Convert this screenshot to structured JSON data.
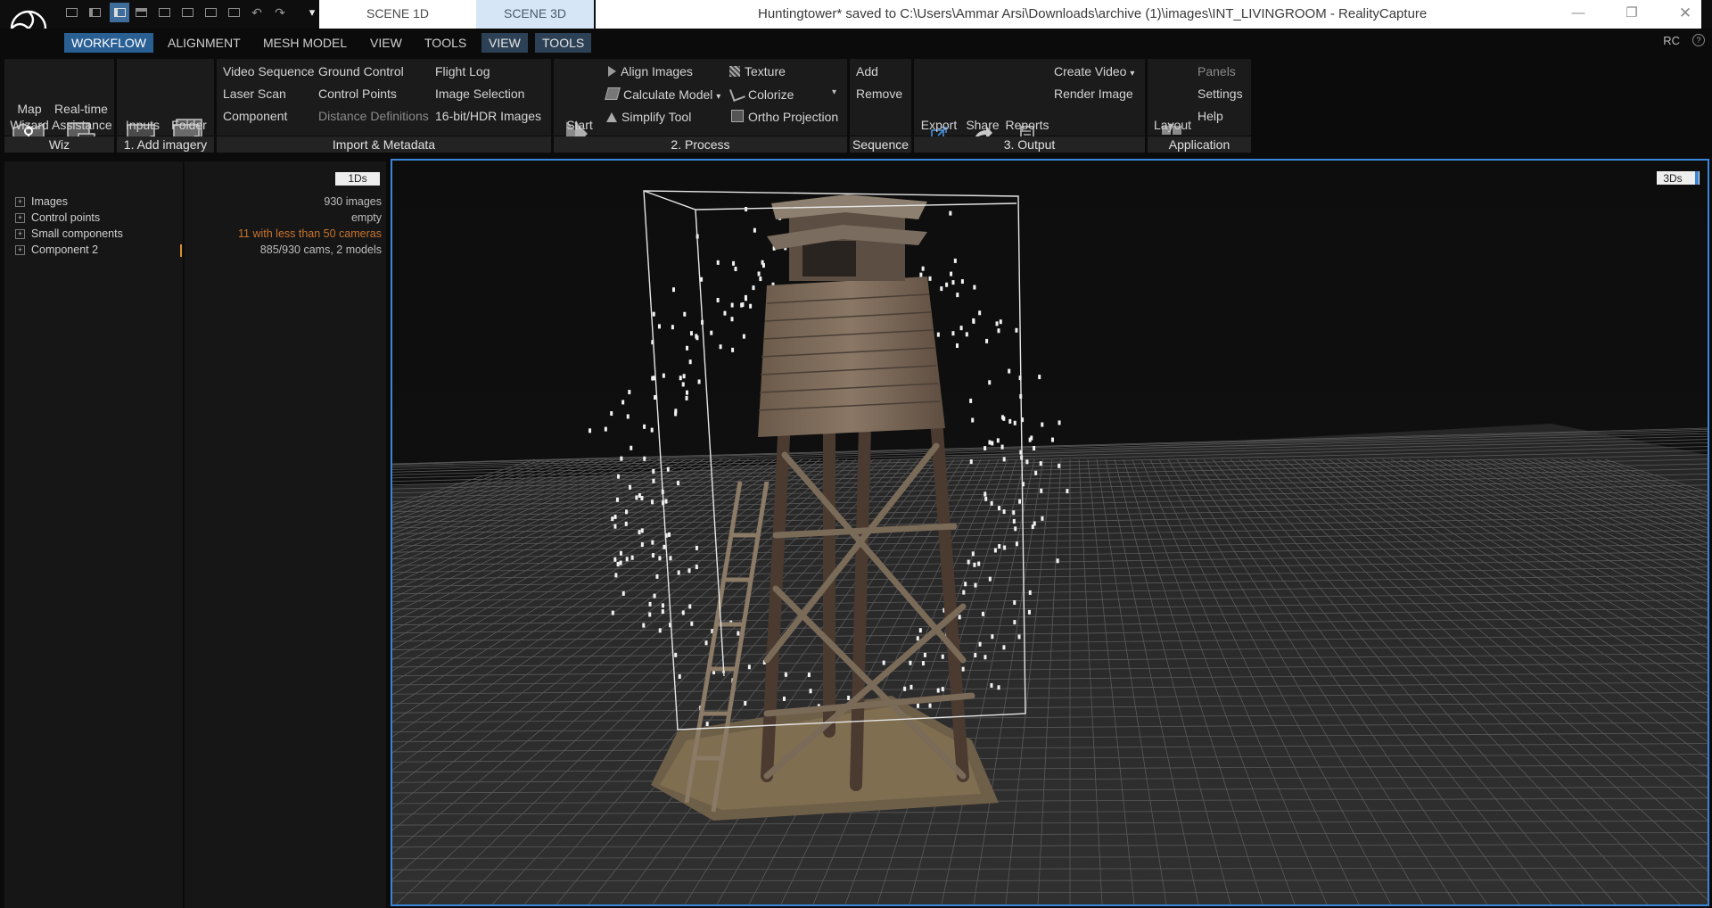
{
  "window": {
    "title": "Huntingtower* saved to C:\\Users\\Ammar Arsi\\Downloads\\archive (1)\\images\\INT_LIVINGROOM - RealityCapture",
    "scene_tabs": [
      "SCENE 1D",
      "SCENE 3D"
    ],
    "quick_access_marker": "▾"
  },
  "menubar": {
    "items": [
      "WORKFLOW",
      "ALIGNMENT",
      "MESH MODEL",
      "VIEW",
      "TOOLS",
      "VIEW",
      "TOOLS"
    ],
    "right_label": "RC",
    "help_glyph": "?"
  },
  "ribbon": {
    "wiz": {
      "label": "Wiz",
      "map_wizard": [
        "Map",
        "Wizard"
      ],
      "realtime": [
        "Real-time",
        "Assistance"
      ]
    },
    "add_imagery": {
      "label": "1. Add imagery",
      "inputs": "Inputs",
      "folder": "Folder"
    },
    "import": {
      "label": "Import & Metadata",
      "col1": [
        "Video Sequence",
        "Laser Scan",
        "Component"
      ],
      "col2": [
        "Ground Control",
        "Control Points",
        "Distance Definitions"
      ],
      "col3": [
        "Flight Log",
        "Image Selection",
        "16-bit/HDR Images"
      ]
    },
    "process": {
      "label": "2. Process",
      "start": "Start",
      "col1": [
        "Align Images",
        "Calculate Model",
        "Simplify Tool"
      ],
      "col2": [
        "Texture",
        "Colorize",
        "Ortho Projection"
      ]
    },
    "sequence": {
      "label": "Sequence",
      "items": [
        "Add",
        "Remove"
      ]
    },
    "output": {
      "label": "3. Output",
      "export": "Export",
      "share": "Share",
      "reports": "Reports",
      "items": [
        "Create Video",
        "Render Image"
      ]
    },
    "application": {
      "label": "Application",
      "layout": "Layout",
      "items": [
        "Panels",
        "Settings",
        "Help"
      ]
    }
  },
  "panel_1ds": {
    "tag": "1Ds",
    "rows": [
      {
        "name": "Images",
        "value": "930 images",
        "warn": false
      },
      {
        "name": "Control points",
        "value": "empty",
        "warn": false
      },
      {
        "name": "Small components",
        "value": "11 with less than 50 cameras",
        "warn": true
      },
      {
        "name": "Component 2",
        "value": "885/930 cams, 2 models",
        "warn": false
      }
    ]
  },
  "viewport_3ds": {
    "tag": "3Ds"
  },
  "colors": {
    "accent": "#2a5f94",
    "viewport_border": "#3a86d8",
    "warning": "#c8742c"
  }
}
